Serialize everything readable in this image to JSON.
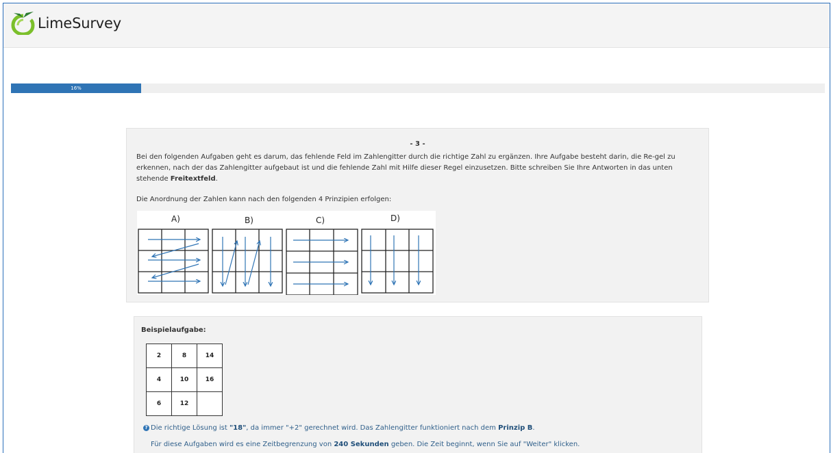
{
  "brand": {
    "name": "LimeSurvey"
  },
  "progress": {
    "label": "16%",
    "value": 16
  },
  "question": {
    "number": "- 3 -",
    "intro_part1": "Bei den folgenden Aufgaben geht es darum, das fehlende Feld im Zahlengitter durch die richtige Zahl zu ergänzen. Ihre Aufgabe besteht darin, die Re-gel zu erkennen, nach der das Zahlengitter aufgebaut ist und die fehlende Zahl mit Hilfe dieser Regel einzusetzen. Bitte schreiben Sie Ihre Antworten in das unten stehende ",
    "intro_bold": "Freitextfeld",
    "intro_end": ".",
    "principles_text": "Die Anordnung der Zahlen kann nach den folgenden 4 Prinzipien erfolgen:",
    "principles": [
      {
        "label": "A)"
      },
      {
        "label": "B)"
      },
      {
        "label": "C)"
      },
      {
        "label": "D)"
      }
    ]
  },
  "example": {
    "title": "Beispielaufgabe:",
    "grid": [
      [
        "2",
        "8",
        "14"
      ],
      [
        "4",
        "10",
        "16"
      ],
      [
        "6",
        "12",
        ""
      ]
    ],
    "solution_pre": "Die richtige Lösung ist ",
    "solution_value": "\"18\"",
    "solution_mid": ", da immer \"+2\" gerechnet wird. Das Zahlengitter funktioniert nach dem ",
    "solution_principle": "Prinzip B",
    "solution_end": ".",
    "time_pre": "Für diese Aufgaben wird es eine Zeitbegrenzung von ",
    "time_value": "240 Sekunden",
    "time_post": " geben. Die Zeit beginnt, wenn Sie auf \"Weiter\" klicken."
  },
  "colors": {
    "accent": "#2f74b5",
    "logo_green": "#7bbf2a",
    "panel_bg": "#f2f2f2"
  }
}
